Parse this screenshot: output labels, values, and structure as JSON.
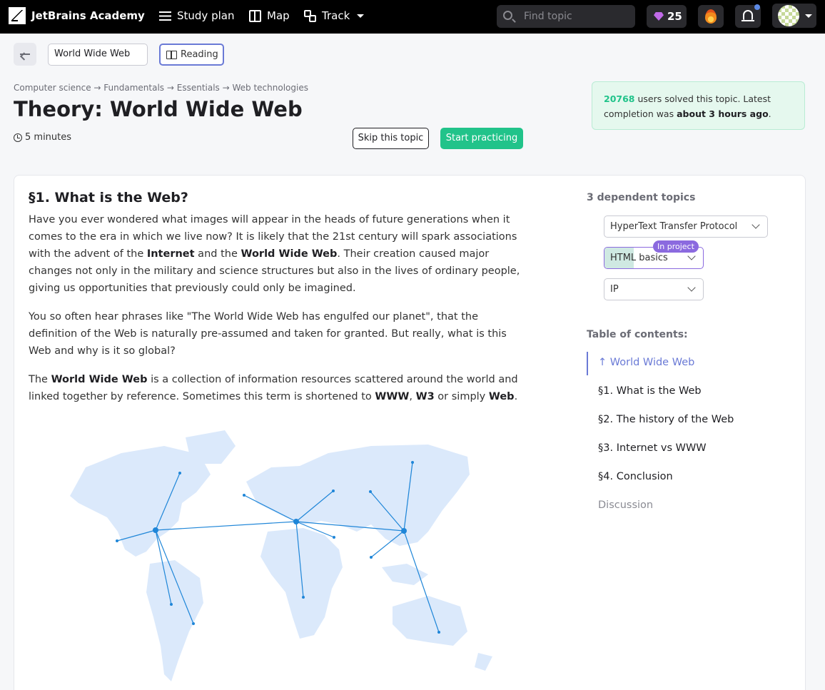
{
  "topnav": {
    "brand": "JetBrains Academy",
    "study_plan": "Study plan",
    "map": "Map",
    "track": "Track",
    "search_placeholder": "Find topic",
    "gems": "25"
  },
  "subheader": {
    "topic_field": "World Wide Web",
    "reading": "Reading"
  },
  "breadcrumb": "Computer science → Fundamentals → Essentials → Web technologies",
  "title": "Theory: World Wide Web",
  "duration": "5 minutes",
  "actions": {
    "skip": "Skip this topic",
    "start": "Start practicing"
  },
  "solved": {
    "count": "20768",
    "text1": " users solved this topic. Latest completion was ",
    "when": "about 3 hours ago",
    "text2": "."
  },
  "section": {
    "title": "§1. What is the Web?",
    "p1": [
      "Have you ever wondered what images will appear in the heads of future generations when it comes to the era in which we live now? It is likely that the 21st century will spark associations with the advent of the ",
      "Internet",
      " and the ",
      "World Wide Web",
      ". Their creation caused major changes not only in the military and science structures but also in the lives of ordinary people, giving us opportunities that previously could only be imagined."
    ],
    "p2": "You so often hear phrases like \"The World Wide Web has engulfed our planet\", that the definition of the Web is naturally pre-assumed and taken for granted. But really, what is this Web and why is it so global?",
    "p3": [
      "The ",
      "World Wide Web",
      " is a collection of information resources scattered around the world and linked together by reference. Sometimes this term is shortened to ",
      "WWW",
      ", ",
      "W3",
      " or simply ",
      "Web",
      "."
    ]
  },
  "dependent": {
    "title": "3 dependent topics",
    "items": [
      "HyperText Transfer Protocol",
      "HTML basics",
      "IP"
    ],
    "badge": "In project",
    "html_progress": 0.3
  },
  "toc": {
    "title": "Table of contents:",
    "items": [
      "↑ World Wide Web",
      "§1. What is the Web",
      "§2. The history of the Web",
      "§3. Internet vs WWW",
      "§4. Conclusion",
      "Discussion"
    ]
  },
  "colors": {
    "accent": "#21c38a",
    "link": "#6a7ad6",
    "badge": "#8b6adf",
    "map_land": "#dbe9fb",
    "map_line": "#1f86d8"
  }
}
